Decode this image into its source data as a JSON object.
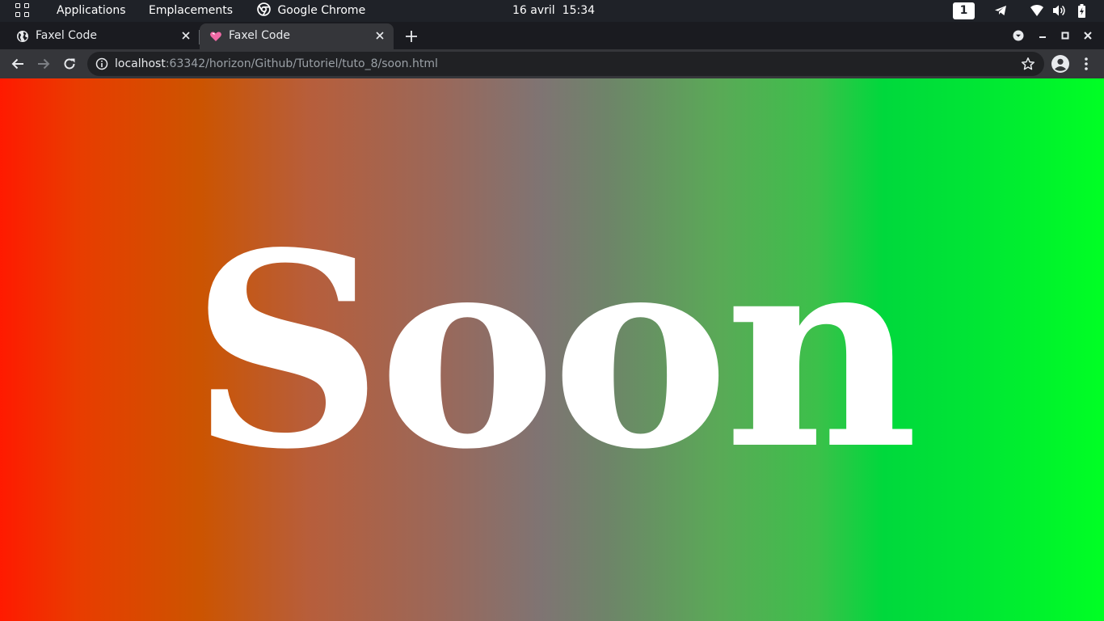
{
  "topbar": {
    "activities_icon": "apps-grid-icon",
    "applications_label": "Applications",
    "places_label": "Emplacements",
    "focused_app_label": "Google Chrome",
    "focused_app_icon": "chrome-icon",
    "date": "16 avril",
    "time": "15:34",
    "workspace_number": "1",
    "tray_icons": [
      "telegram-icon",
      "wifi-icon",
      "volume-icon",
      "battery-icon"
    ]
  },
  "tabs": [
    {
      "title": "Faxel Code",
      "favicon": "globe-icon",
      "active": false
    },
    {
      "title": "Faxel Code",
      "favicon": "heart-icon",
      "active": true
    }
  ],
  "toolbar": {
    "url_host": "localhost",
    "url_rest": ":63342/horizon/Github/Tutoriel/tuto_8/soon.html"
  },
  "page": {
    "heading": "Soon",
    "gradient_colors": [
      "#ff1a00",
      "#cc5400",
      "#7f7473",
      "#00d83c",
      "#00ff24"
    ]
  },
  "colors": {
    "topbar_bg": "#1f2228",
    "tabstrip_bg": "#1a1b20",
    "toolbar_bg": "#35363a",
    "omnibox_bg": "#202124"
  }
}
